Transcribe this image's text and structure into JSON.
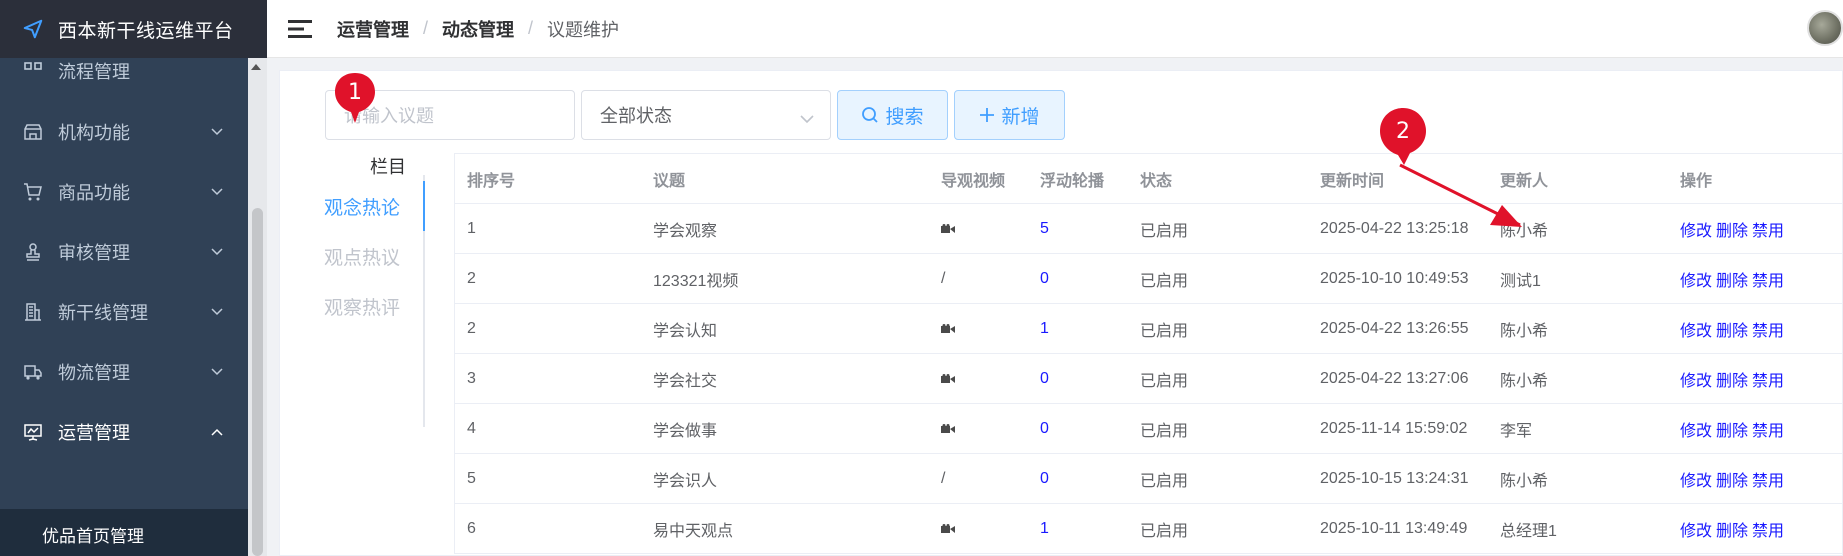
{
  "app": {
    "title": "西本新干线运维平台"
  },
  "sidebar": {
    "partial_label": "流程管理",
    "items": [
      {
        "label": "机构功能",
        "icon": "store-icon"
      },
      {
        "label": "商品功能",
        "icon": "cart-icon"
      },
      {
        "label": "审核管理",
        "icon": "stamp-icon"
      },
      {
        "label": "新干线管理",
        "icon": "building-icon"
      },
      {
        "label": "物流管理",
        "icon": "truck-icon"
      },
      {
        "label": "运营管理",
        "icon": "presentation-icon"
      }
    ],
    "active_sub": "优品首页管理"
  },
  "header": {
    "breadcrumb": [
      "运营管理",
      "动态管理",
      "议题维护"
    ]
  },
  "filters": {
    "search_placeholder": "请输入议题",
    "status_value": "全部状态",
    "search_button": "搜索",
    "add_button": "新增"
  },
  "columns_nav": {
    "title": "栏目",
    "items": [
      "观念热论",
      "观点热议",
      "观察热评"
    ],
    "active_index": 0
  },
  "table": {
    "headers": [
      "排序号",
      "议题",
      "导观视频",
      "浮动轮播",
      "状态",
      "更新时间",
      "更新人",
      "操作"
    ],
    "rows": [
      {
        "no": "1",
        "topic": "学会观察",
        "video": "icon",
        "carousel": "5",
        "status": "已启用",
        "time": "2025-04-22 13:25:18",
        "user": "陈小希"
      },
      {
        "no": "2",
        "topic": "123321视频",
        "video": "/",
        "carousel": "0",
        "status": "已启用",
        "time": "2025-10-10 10:49:53",
        "user": "测试1"
      },
      {
        "no": "2",
        "topic": "学会认知",
        "video": "icon",
        "carousel": "1",
        "status": "已启用",
        "time": "2025-04-22 13:26:55",
        "user": "陈小希"
      },
      {
        "no": "3",
        "topic": "学会社交",
        "video": "icon",
        "carousel": "0",
        "status": "已启用",
        "time": "2025-04-22 13:27:06",
        "user": "陈小希"
      },
      {
        "no": "4",
        "topic": "学会做事",
        "video": "icon",
        "carousel": "0",
        "status": "已启用",
        "time": "2025-11-14 15:59:02",
        "user": "李军"
      },
      {
        "no": "5",
        "topic": "学会识人",
        "video": "/",
        "carousel": "0",
        "status": "已启用",
        "time": "2025-10-15 13:24:31",
        "user": "陈小希"
      },
      {
        "no": "6",
        "topic": "易中天观点",
        "video": "icon",
        "carousel": "1",
        "status": "已启用",
        "time": "2025-10-11 13:49:49",
        "user": "总经理1"
      }
    ],
    "ops": {
      "edit": "修改",
      "delete": "删除",
      "disable": "禁用"
    }
  },
  "annotations": {
    "marker1": "1",
    "marker2": "2"
  },
  "colors": {
    "accent": "#409eff",
    "sidebar_bg": "#304156",
    "link": "#1a1aff",
    "marker": "#e0122a"
  }
}
